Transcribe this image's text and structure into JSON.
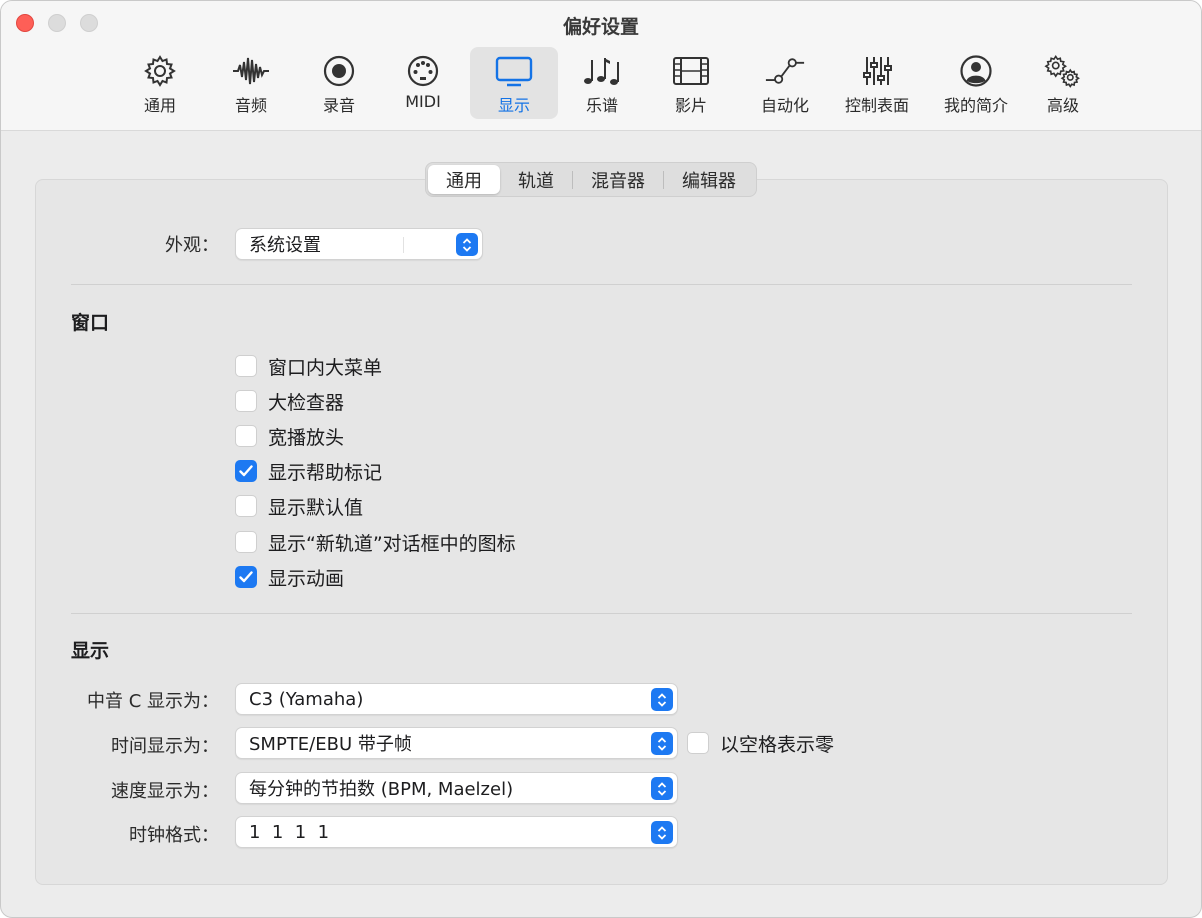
{
  "window": {
    "title": "偏好设置"
  },
  "toolbar": {
    "items": [
      {
        "label": "通用",
        "icon": "gear-icon"
      },
      {
        "label": "音频",
        "icon": "waveform-icon"
      },
      {
        "label": "录音",
        "icon": "record-icon"
      },
      {
        "label": "MIDI",
        "icon": "midi-port-icon"
      },
      {
        "label": "显示",
        "icon": "display-icon",
        "selected": true
      },
      {
        "label": "乐谱",
        "icon": "music-notes-icon"
      },
      {
        "label": "影片",
        "icon": "film-strip-icon"
      },
      {
        "label": "自动化",
        "icon": "automation-curve-icon"
      },
      {
        "label": "控制表面",
        "icon": "faders-icon"
      },
      {
        "label": "我的简介",
        "icon": "profile-icon"
      },
      {
        "label": "高级",
        "icon": "gears-icon"
      }
    ]
  },
  "tabs": [
    "通用",
    "轨道",
    "混音器",
    "编辑器"
  ],
  "appearance": {
    "label": "外观：",
    "value": "系统设置"
  },
  "windows_section": {
    "title": "窗口",
    "options": [
      {
        "label": "窗口内大菜单",
        "checked": false
      },
      {
        "label": "大检查器",
        "checked": false
      },
      {
        "label": "宽播放头",
        "checked": false
      },
      {
        "label": "显示帮助标记",
        "checked": true
      },
      {
        "label": "显示默认值",
        "checked": false
      },
      {
        "label": "显示“新轨道”对话框中的图标",
        "checked": false
      },
      {
        "label": "显示动画",
        "checked": true
      }
    ]
  },
  "display_section": {
    "title": "显示",
    "middle_c": {
      "label": "中音 C 显示为：",
      "value": "C3 (Yamaha)"
    },
    "time": {
      "label": "时间显示为：",
      "value": "SMPTE/EBU 带子帧"
    },
    "space_zero": {
      "label": "以空格表示零",
      "checked": false
    },
    "tempo": {
      "label": "速度显示为：",
      "value": "每分钟的节拍数 (BPM, Maelzel)"
    },
    "clock": {
      "label": "时钟格式：",
      "value": "1  1  1  1"
    }
  },
  "colors": {
    "accent": "#1d79f2",
    "close": "#fe5f57"
  }
}
